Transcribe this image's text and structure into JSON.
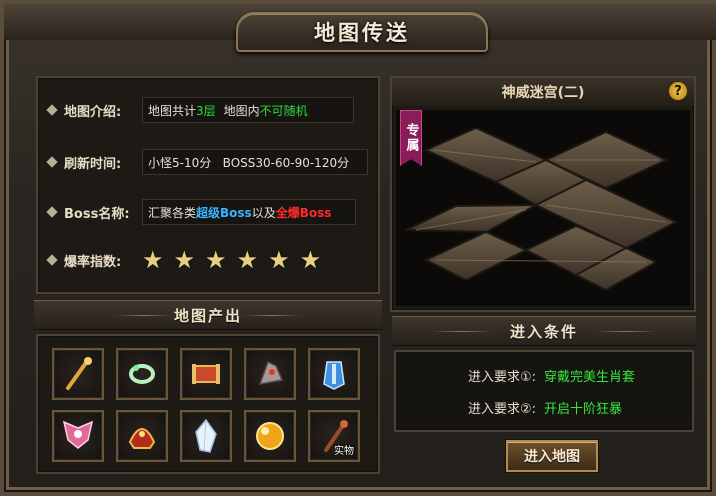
{
  "window": {
    "title": "地图传送"
  },
  "info": {
    "intro_label": "地图介绍:",
    "intro_parts": [
      "地图共计",
      "3层",
      "地图内",
      "不可随机"
    ],
    "refresh_label": "刷新时间:",
    "refresh_value": "小怪5-10分   BOSS30-60-90-120分",
    "boss_label": "Boss名称:",
    "boss_parts": [
      "汇聚各类",
      "超级Boss",
      "以及",
      "全爆Boss"
    ],
    "rate_label": "爆率指数:",
    "rate_stars": 6,
    "rate_max": 6
  },
  "drops": {
    "title": "地图产出",
    "items": [
      {
        "icon": "golden-staff-icon"
      },
      {
        "icon": "jade-bracelet-icon"
      },
      {
        "icon": "red-scroll-icon"
      },
      {
        "icon": "silver-gauntlet-icon"
      },
      {
        "icon": "blue-armor-icon"
      },
      {
        "icon": "pink-wings-icon"
      },
      {
        "icon": "red-helmet-icon"
      },
      {
        "icon": "white-crystal-icon"
      },
      {
        "icon": "gold-orb-icon"
      },
      {
        "icon": "physical-staff-icon",
        "tag": "实物"
      }
    ]
  },
  "map": {
    "name": "神威迷宫(二)",
    "help": "?",
    "ribbon": "专属"
  },
  "requirements": {
    "title": "进入条件",
    "items": [
      {
        "label": "进入要求①:",
        "value": "穿戴完美生肖套"
      },
      {
        "label": "进入要求②:",
        "value": "开启十阶狂暴"
      }
    ]
  },
  "actions": {
    "enter": "进入地图"
  },
  "colors": {
    "highlight_green": "#2fdc3a",
    "highlight_blue": "#39b5ff",
    "highlight_red": "#ff2a2a",
    "star": "#e8cf86"
  }
}
